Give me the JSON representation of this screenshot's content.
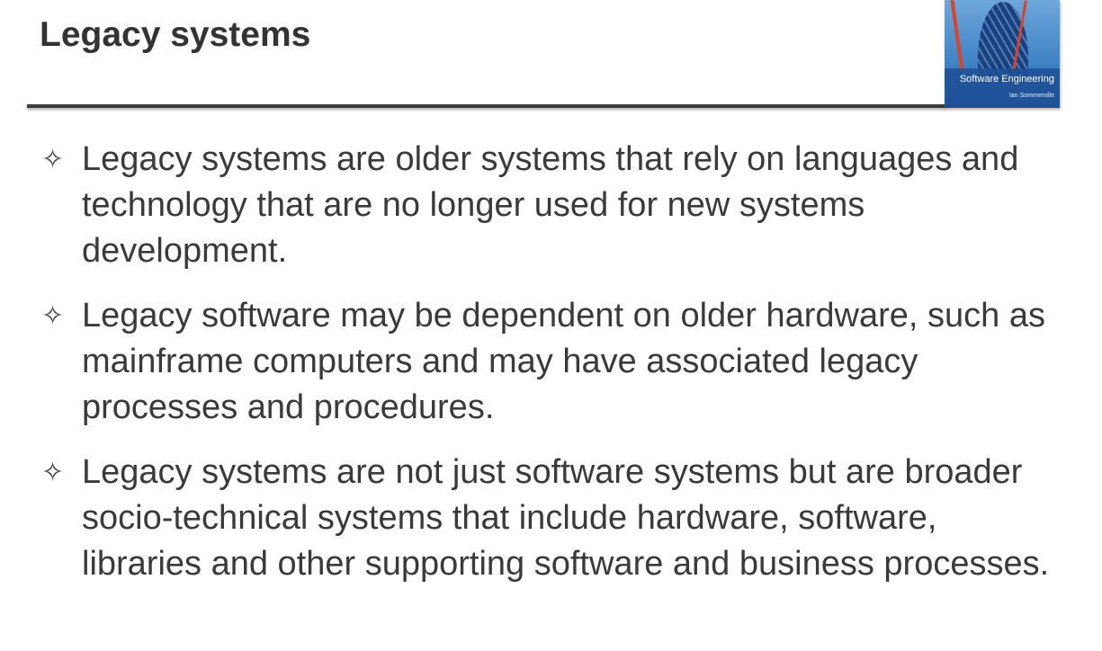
{
  "slide": {
    "title": "Legacy systems",
    "cover": {
      "title": "Software Engineering",
      "author": "Ian Sommerville"
    },
    "bullets": [
      {
        "icon": "four-pointed-star-icon",
        "text": "Legacy systems are older systems that rely on languages and technology that are no longer used for new systems development."
      },
      {
        "icon": "four-pointed-star-icon",
        "text": "Legacy software may be dependent on older hardware, such as mainframe computers and may have associated legacy processes and procedures."
      },
      {
        "icon": "four-pointed-star-icon",
        "text": "Legacy systems are not just software systems but are broader socio-technical systems that include hardware, software, libraries and other supporting software and business processes."
      }
    ]
  }
}
